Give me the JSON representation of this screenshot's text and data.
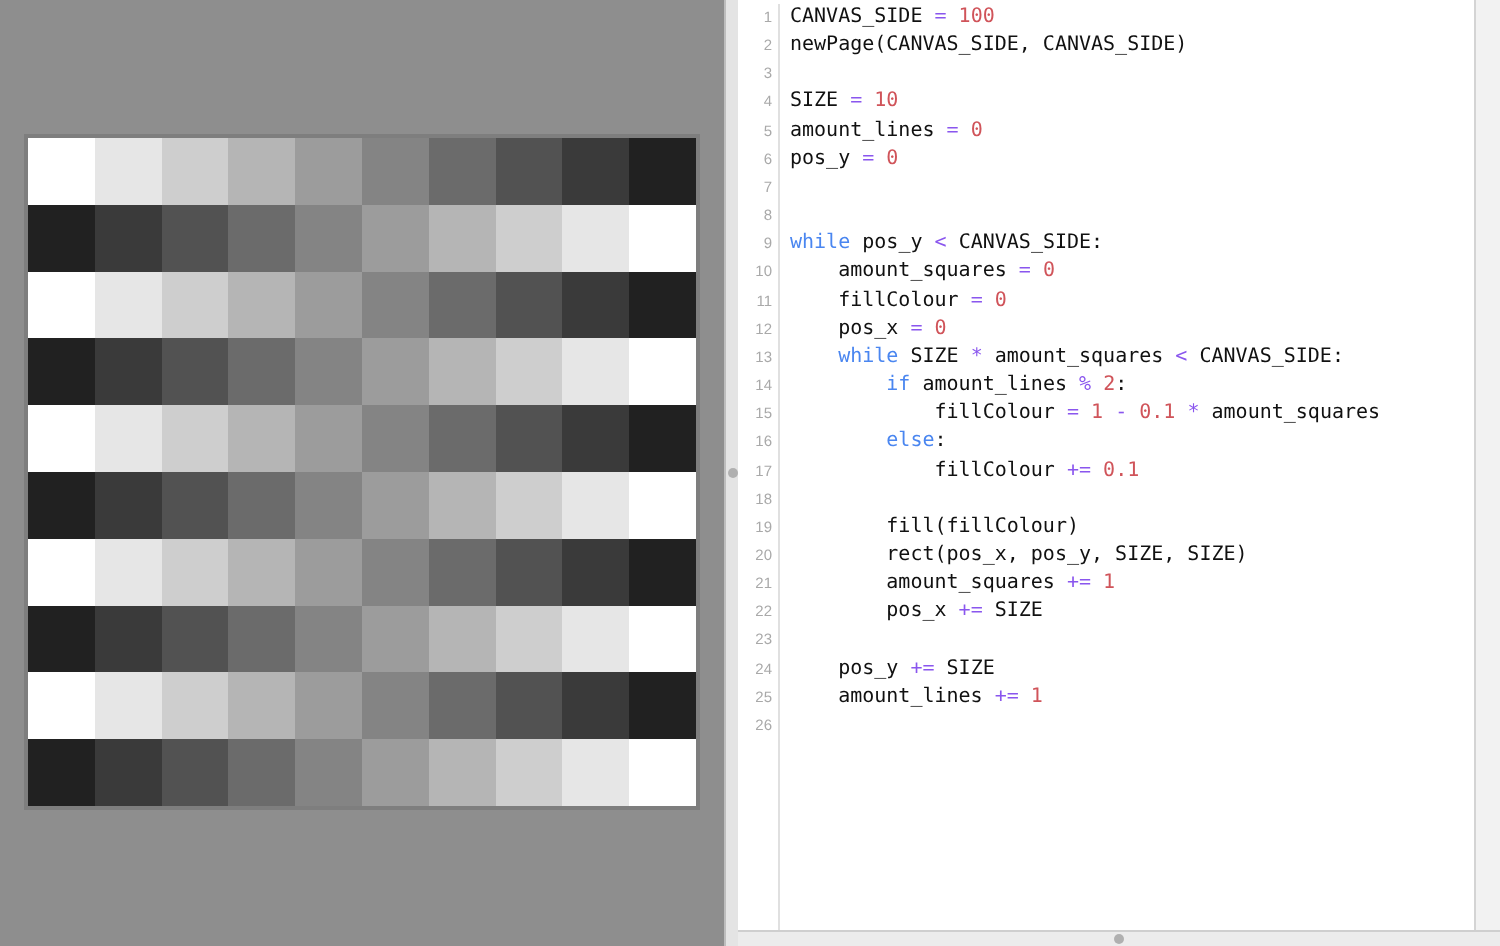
{
  "editor": {
    "lines": [
      {
        "number": "1",
        "tokens": [
          {
            "kind": "plain",
            "text": "CANVAS_SIDE "
          },
          {
            "kind": "operator",
            "text": "= "
          },
          {
            "kind": "number",
            "text": "100"
          }
        ]
      },
      {
        "number": "2",
        "tokens": [
          {
            "kind": "plain",
            "text": "newPage(CANVAS_SIDE, CANVAS_SIDE)"
          }
        ]
      },
      {
        "number": "3"
      },
      {
        "number": "4",
        "tokens": [
          {
            "kind": "plain",
            "text": "SIZE "
          },
          {
            "kind": "operator",
            "text": "= "
          },
          {
            "kind": "number",
            "text": "10"
          }
        ]
      },
      {
        "number": "5",
        "tokens": [
          {
            "kind": "plain",
            "text": "amount_lines "
          },
          {
            "kind": "operator",
            "text": "= "
          },
          {
            "kind": "number",
            "text": "0"
          }
        ]
      },
      {
        "number": "6",
        "tokens": [
          {
            "kind": "plain",
            "text": "pos_y "
          },
          {
            "kind": "operator",
            "text": "= "
          },
          {
            "kind": "number",
            "text": "0"
          }
        ]
      },
      {
        "number": "7"
      },
      {
        "number": "8"
      },
      {
        "number": "9",
        "tokens": [
          {
            "kind": "keyword",
            "text": "while"
          },
          {
            "kind": "plain",
            "text": " pos_y "
          },
          {
            "kind": "operator",
            "text": "<"
          },
          {
            "kind": "plain",
            "text": " CANVAS_SIDE:"
          }
        ]
      },
      {
        "number": "10",
        "tokens": [
          {
            "kind": "plain",
            "text": "    amount_squares "
          },
          {
            "kind": "operator",
            "text": "= "
          },
          {
            "kind": "number",
            "text": "0"
          }
        ]
      },
      {
        "number": "11",
        "tokens": [
          {
            "kind": "plain",
            "text": "    fillColour "
          },
          {
            "kind": "operator",
            "text": "= "
          },
          {
            "kind": "number",
            "text": "0"
          }
        ]
      },
      {
        "number": "12",
        "tokens": [
          {
            "kind": "plain",
            "text": "    pos_x "
          },
          {
            "kind": "operator",
            "text": "= "
          },
          {
            "kind": "number",
            "text": "0"
          }
        ]
      },
      {
        "number": "13",
        "tokens": [
          {
            "kind": "keyword",
            "text": "    while"
          },
          {
            "kind": "plain",
            "text": " SIZE "
          },
          {
            "kind": "operator",
            "text": "*"
          },
          {
            "kind": "plain",
            "text": " amount_squares "
          },
          {
            "kind": "operator",
            "text": "<"
          },
          {
            "kind": "plain",
            "text": " CANVAS_SIDE:"
          }
        ]
      },
      {
        "number": "14",
        "tokens": [
          {
            "kind": "keyword",
            "text": "        if"
          },
          {
            "kind": "plain",
            "text": " amount_lines "
          },
          {
            "kind": "operator",
            "text": "% "
          },
          {
            "kind": "number",
            "text": "2"
          },
          {
            "kind": "plain",
            "text": ":"
          }
        ]
      },
      {
        "number": "15",
        "tokens": [
          {
            "kind": "plain",
            "text": "            fillColour "
          },
          {
            "kind": "operator",
            "text": "= "
          },
          {
            "kind": "number",
            "text": "1 "
          },
          {
            "kind": "operator",
            "text": "- "
          },
          {
            "kind": "number",
            "text": "0.1 "
          },
          {
            "kind": "operator",
            "text": "*"
          },
          {
            "kind": "plain",
            "text": " amount_squares"
          }
        ]
      },
      {
        "number": "16",
        "tokens": [
          {
            "kind": "keyword",
            "text": "        else"
          },
          {
            "kind": "plain",
            "text": ":"
          }
        ]
      },
      {
        "number": "17",
        "tokens": [
          {
            "kind": "plain",
            "text": "            fillColour "
          },
          {
            "kind": "operator",
            "text": "+= "
          },
          {
            "kind": "number",
            "text": "0.1"
          }
        ]
      },
      {
        "number": "18"
      },
      {
        "number": "19",
        "tokens": [
          {
            "kind": "plain",
            "text": "        fill(fillColour)"
          }
        ]
      },
      {
        "number": "20",
        "tokens": [
          {
            "kind": "plain",
            "text": "        rect(pos_x, pos_y, SIZE, SIZE)"
          }
        ]
      },
      {
        "number": "21",
        "tokens": [
          {
            "kind": "plain",
            "text": "        amount_squares "
          },
          {
            "kind": "operator",
            "text": "+= "
          },
          {
            "kind": "number",
            "text": "1"
          }
        ]
      },
      {
        "number": "22",
        "tokens": [
          {
            "kind": "plain",
            "text": "        pos_x "
          },
          {
            "kind": "operator",
            "text": "+="
          },
          {
            "kind": "plain",
            "text": " SIZE"
          }
        ]
      },
      {
        "number": "23"
      },
      {
        "number": "24",
        "tokens": [
          {
            "kind": "plain",
            "text": "    pos_y "
          },
          {
            "kind": "operator",
            "text": "+="
          },
          {
            "kind": "plain",
            "text": " SIZE"
          }
        ]
      },
      {
        "number": "25",
        "tokens": [
          {
            "kind": "plain",
            "text": "    amount_lines "
          },
          {
            "kind": "operator",
            "text": "+= "
          },
          {
            "kind": "number",
            "text": "1"
          }
        ]
      },
      {
        "number": "26"
      }
    ]
  }
}
